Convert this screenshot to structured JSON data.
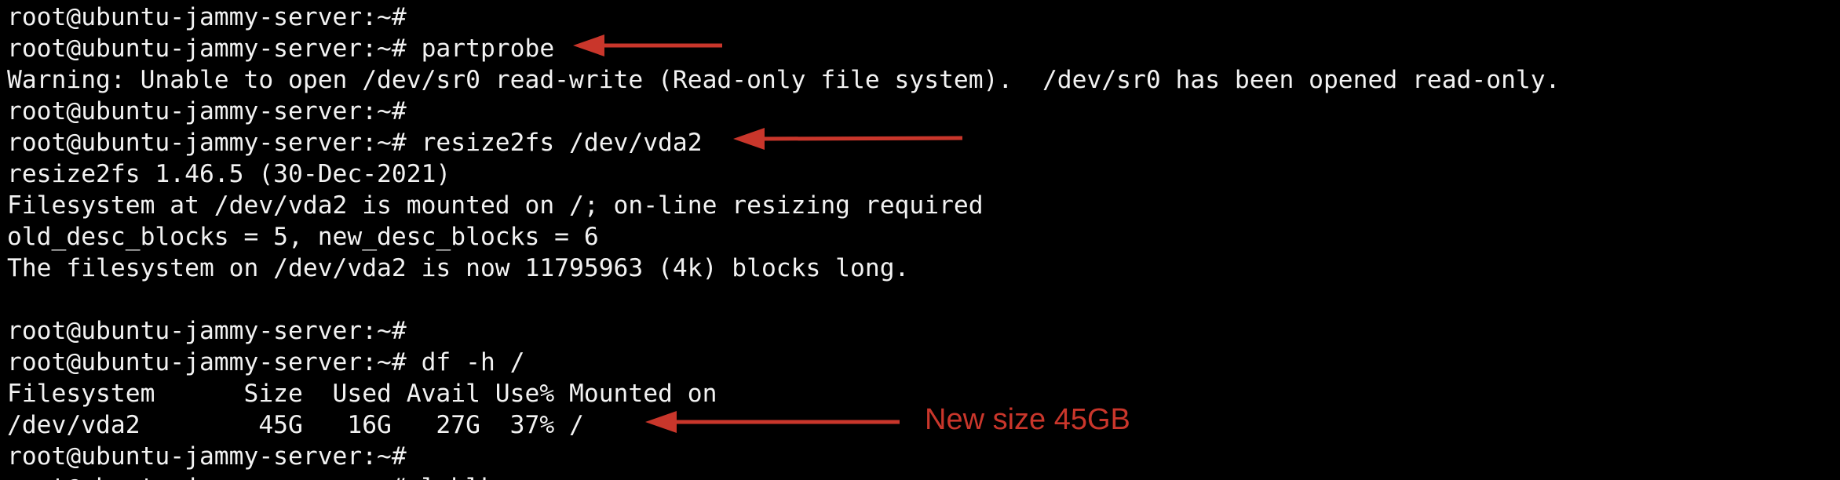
{
  "terminal": {
    "lines": [
      "root@ubuntu-jammy-server:~#",
      "root@ubuntu-jammy-server:~# partprobe",
      "Warning: Unable to open /dev/sr0 read-write (Read-only file system).  /dev/sr0 has been opened read-only.",
      "root@ubuntu-jammy-server:~#",
      "root@ubuntu-jammy-server:~# resize2fs /dev/vda2",
      "resize2fs 1.46.5 (30-Dec-2021)",
      "Filesystem at /dev/vda2 is mounted on /; on-line resizing required",
      "old_desc_blocks = 5, new_desc_blocks = 6",
      "The filesystem on /dev/vda2 is now 11795963 (4k) blocks long.",
      "",
      "root@ubuntu-jammy-server:~#",
      "root@ubuntu-jammy-server:~# df -h /",
      "Filesystem      Size  Used Avail Use% Mounted on",
      "/dev/vda2        45G   16G   27G  37% /",
      "root@ubuntu-jammy-server:~#",
      "root@ubuntu-jammy-server:~# lsblk"
    ]
  },
  "annotations": {
    "new_size_label": "New size 45GB",
    "color": "#c9362b"
  },
  "colors": {
    "background": "#000000",
    "text": "#f2f2f2"
  }
}
